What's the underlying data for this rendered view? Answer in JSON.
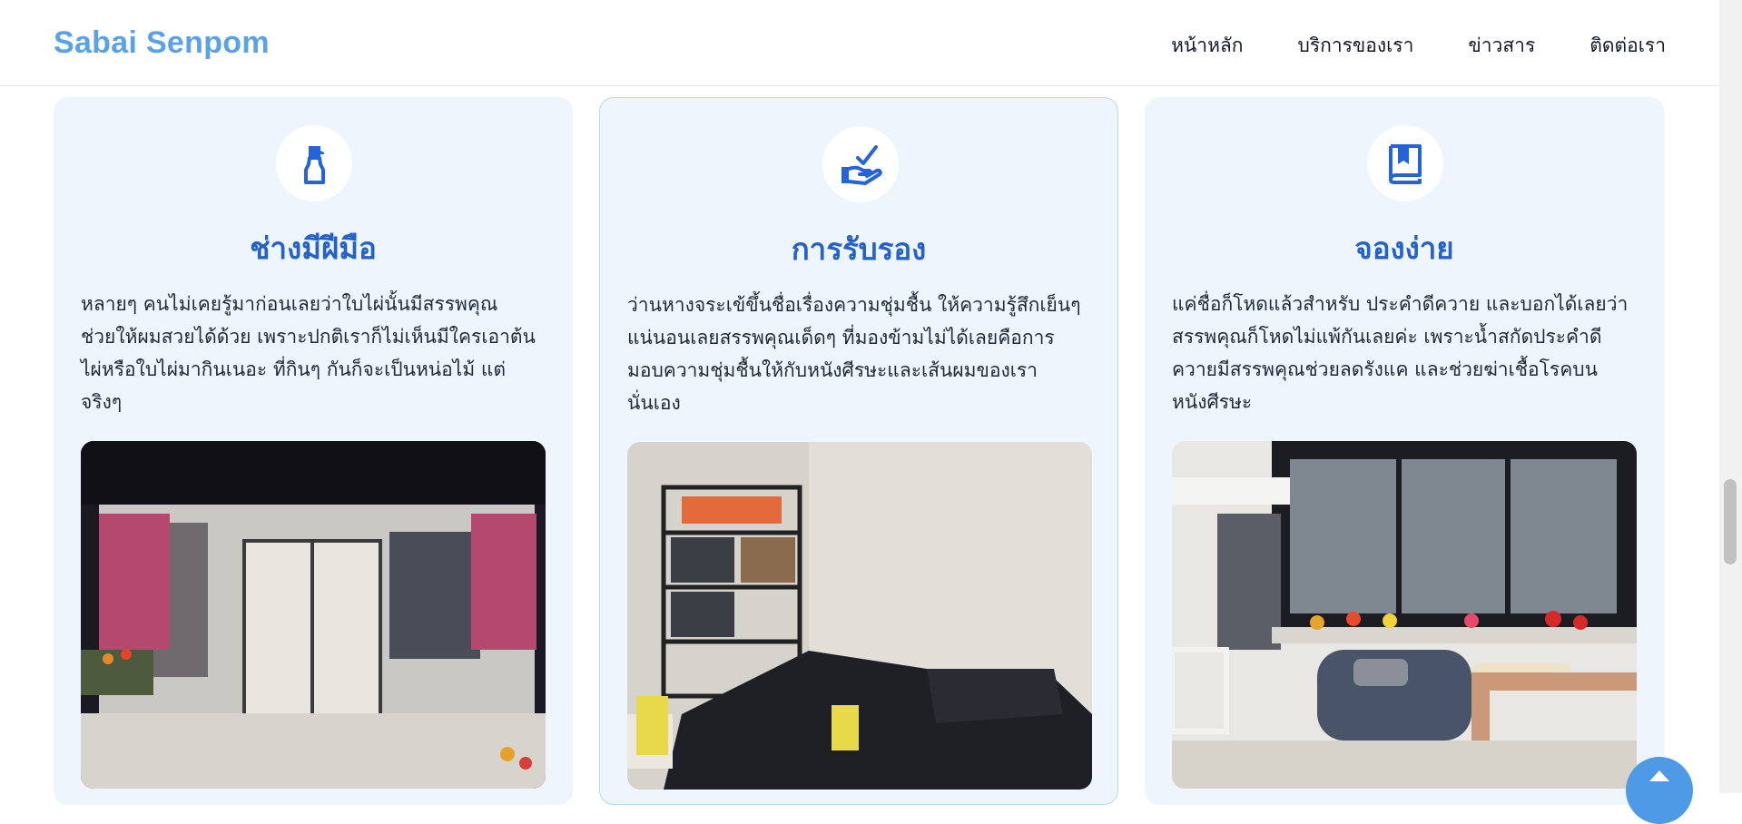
{
  "header": {
    "brand": "Sabai Senpom",
    "nav": [
      "หน้าหลัก",
      "บริการของเรา",
      "ข่าวสาร",
      "ติดต่อเรา"
    ]
  },
  "cards": [
    {
      "icon": "spray-bottle-icon",
      "title": "ช่างมีฝีมือ",
      "desc_lines": [
        "หลายๆ คนไม่เคยรู้มาก่อนเลยว่าใบไผ่นั้นมีสรรพคุณ",
        "ช่วยให้ผมสวยได้ด้วย เพราะปกติเราก็ไม่เห็นมีใครเอาต้น",
        "ไผ่หรือใบไผ่มากินเนอะ ที่กินๆ กันก็จะเป็นหน่อไม้ แต่",
        "จริงๆ"
      ],
      "photo": "salon-storefront-photo"
    },
    {
      "icon": "hand-check-icon",
      "title": "การรับรอง",
      "desc_lines": [
        "ว่านหางจระเข้ขึ้นชื่อเรื่องความชุ่มชื้น ให้ความรู้สึกเย็นๆ",
        "แน่นอนเลยสรรพคุณเด็ดๆ ที่มองข้ามไม่ได้เลยคือการ",
        "มอบความชุ่มชื้นให้กับหนังศีรษะและเส้นผมของเรา",
        "นั่นเอง"
      ],
      "photo": "hair-wash-beds-photo"
    },
    {
      "icon": "book-icon",
      "title": "จองง่าย",
      "desc_lines": [
        "แค่ชื่อก็โหดแล้วสำหรับ ประคำดีควาย และบอกได้เลยว่า",
        "สรรพคุณก็โหดไม่แพ้กันเลยค่ะ เพราะน้ำสกัดประคำดี",
        "ควายมีสรรพคุณช่วยลดรังแค และช่วยฆ่าเชื้อโรคบน",
        "หนังศีรษะ"
      ],
      "photo": "waiting-lounge-photo"
    }
  ],
  "colors": {
    "brand": "#5aa2e8",
    "title": "#2461c9",
    "card_bg": "#eef5fd",
    "icon": "#2563d9"
  }
}
